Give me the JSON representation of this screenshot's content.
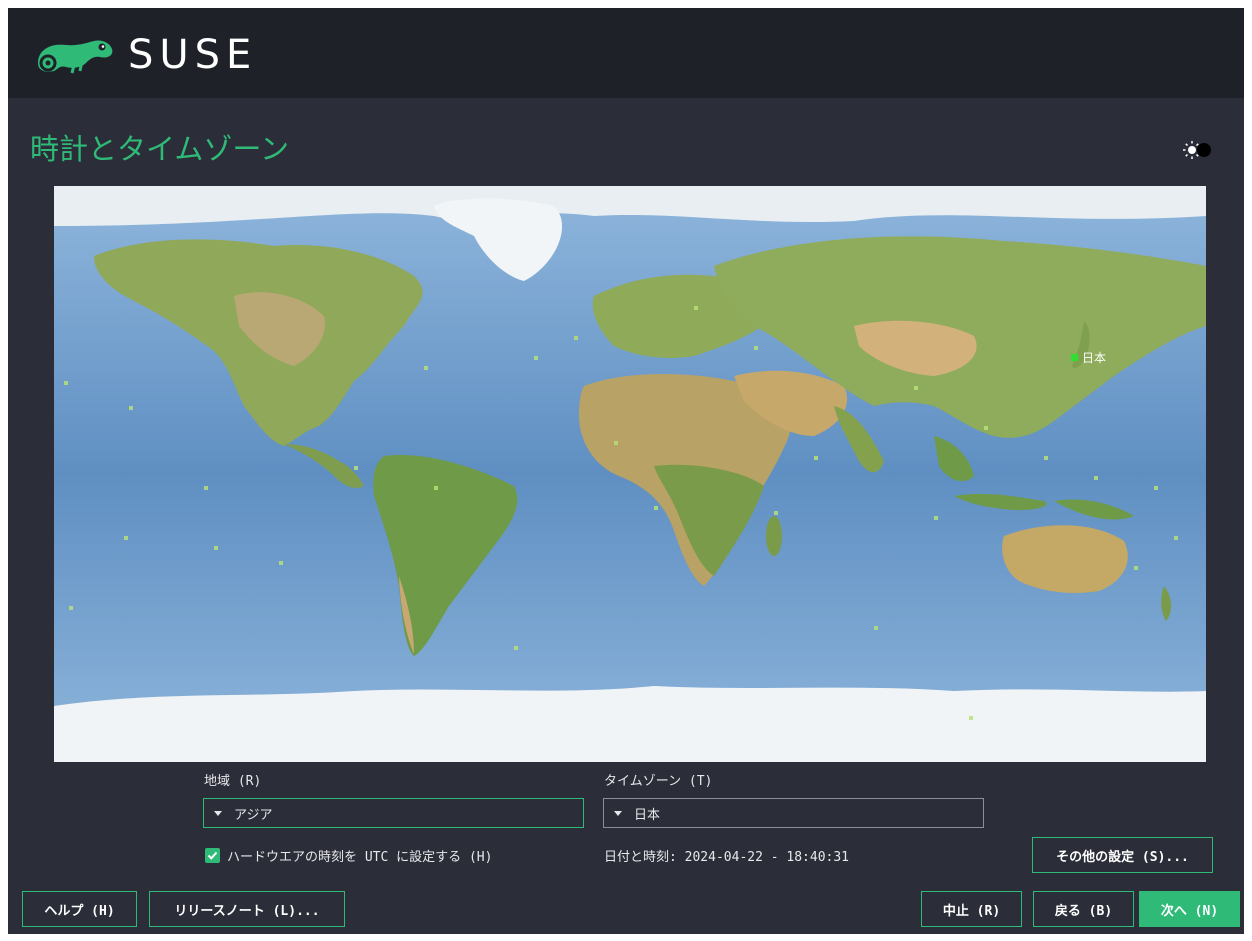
{
  "header": {
    "brand": "SUSE"
  },
  "page": {
    "title": "時計とタイムゾーン"
  },
  "map": {
    "selected_location_label": "日本"
  },
  "region": {
    "label": "地域 (R)",
    "value": "アジア"
  },
  "timezone": {
    "label": "タイムゾーン (T)",
    "value": "日本"
  },
  "hardware_clock": {
    "label": "ハードウエアの時刻を UTC に設定する (H)",
    "checked": true
  },
  "datetime": {
    "text": "日付と時刻: 2024-04-22 - 18:40:31"
  },
  "buttons": {
    "other_settings": "その他の設定 (S)...",
    "help": "ヘルプ (H)",
    "release_notes": "リリースノート (L)...",
    "abort": "中止 (R)",
    "back": "戻る (B)",
    "next": "次へ (N)"
  },
  "colors": {
    "accent": "#30ba78",
    "background": "#2b2e38",
    "header": "#1f2129"
  }
}
